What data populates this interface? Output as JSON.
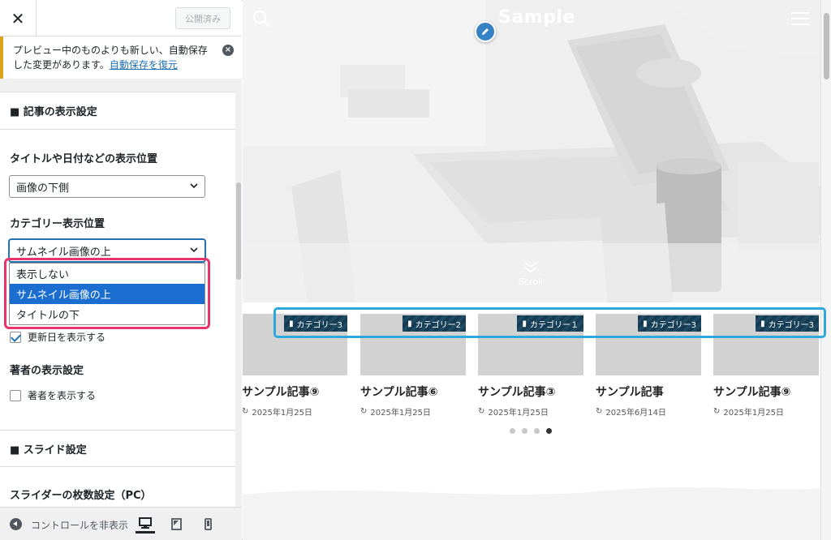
{
  "header": {
    "close_icon_glyph": "✕",
    "publish_label": "公開済み"
  },
  "notice": {
    "text": "プレビュー中のものよりも新しい、自動保存した変更があります。",
    "link": "自動保存を復元"
  },
  "sections": {
    "post_display": "■ 記事の表示設定",
    "slide": "■ スライド設定"
  },
  "fields": {
    "title_position_label": "タイトルや日付などの表示位置",
    "title_position_value": "画像の下側",
    "category_position_label": "カテゴリー表示位置",
    "category_position_value": "サムネイル画像の上",
    "category_options": [
      "表示しない",
      "サムネイル画像の上",
      "タイトルの下"
    ],
    "category_selected_index": 1,
    "show_updated_label": "更新日を表示する",
    "show_updated_checked": true,
    "author_label": "著者の表示設定",
    "show_author_label": "著者を表示する",
    "show_author_checked": false,
    "slider_count_label": "スライダーの枚数設定（PC）"
  },
  "footer": {
    "collapse_label": "コントロールを非表示",
    "devices": [
      "desktop-icon",
      "tablet-icon",
      "mobile-icon"
    ],
    "active_device": "desktop-icon"
  },
  "preview": {
    "site_title": "Sample",
    "scroll_label": "Scroll",
    "cards": [
      {
        "category": "カテゴリー3",
        "title": "サンプル記事⑨",
        "date": "2025年1月25日"
      },
      {
        "category": "カテゴリー2",
        "title": "サンプル記事⑥",
        "date": "2025年1月25日"
      },
      {
        "category": "カテゴリー１",
        "title": "サンプル記事③",
        "date": "2025年1月25日"
      },
      {
        "category": "カテゴリー3",
        "title": "サンプル記事",
        "date": "2025年6月14日"
      },
      {
        "category": "カテゴリー3",
        "title": "サンプル記事⑨",
        "date": "2025年1月25日"
      }
    ],
    "pagination_dots": 4,
    "pagination_active": 3
  },
  "colors": {
    "accent": "#2271b1",
    "dropdown_selected": "#1b6ecf",
    "highlight_pink": "#e8336b",
    "highlight_cyan": "#2ca8dd",
    "category_badge": "#153b53"
  }
}
